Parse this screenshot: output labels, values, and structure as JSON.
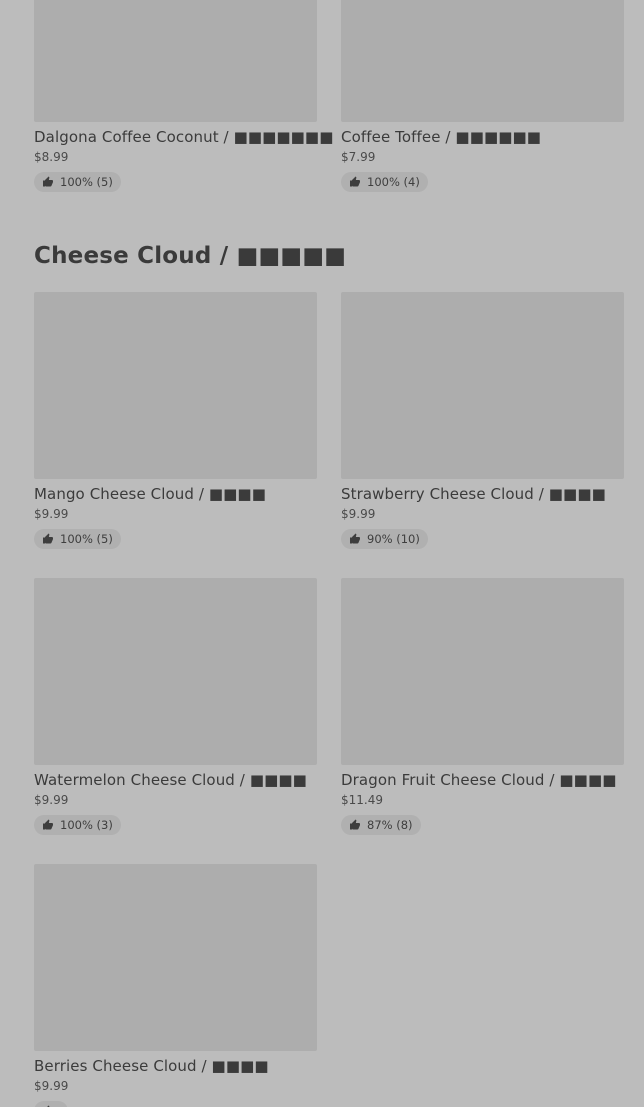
{
  "previous_section": {
    "items": [
      {
        "name": "Dalgona Coffee Coconut / ■■■■■■■",
        "price": "$8.99",
        "rating": "100% (5)"
      },
      {
        "name": "Coffee Toffee / ■■■■■■",
        "price": "$7.99",
        "rating": "100% (4)"
      }
    ]
  },
  "section": {
    "title": "Cheese Cloud / ■■■■■",
    "items": [
      {
        "name": "Mango Cheese Cloud / ■■■■",
        "price": "$9.99",
        "rating": "100% (5)"
      },
      {
        "name": "Strawberry Cheese Cloud / ■■■■",
        "price": "$9.99",
        "rating": "90% (10)"
      },
      {
        "name": "Watermelon Cheese Cloud / ■■■■",
        "price": "$9.99",
        "rating": "100% (3)"
      },
      {
        "name": "Dragon Fruit Cheese Cloud / ■■■■",
        "price": "$11.49",
        "rating": "87% (8)"
      },
      {
        "name": "Berries Cheese Cloud / ■■■■",
        "price": "$9.99",
        "rating": ""
      }
    ]
  },
  "icons": {
    "rating": "thumbs-up-icon"
  }
}
